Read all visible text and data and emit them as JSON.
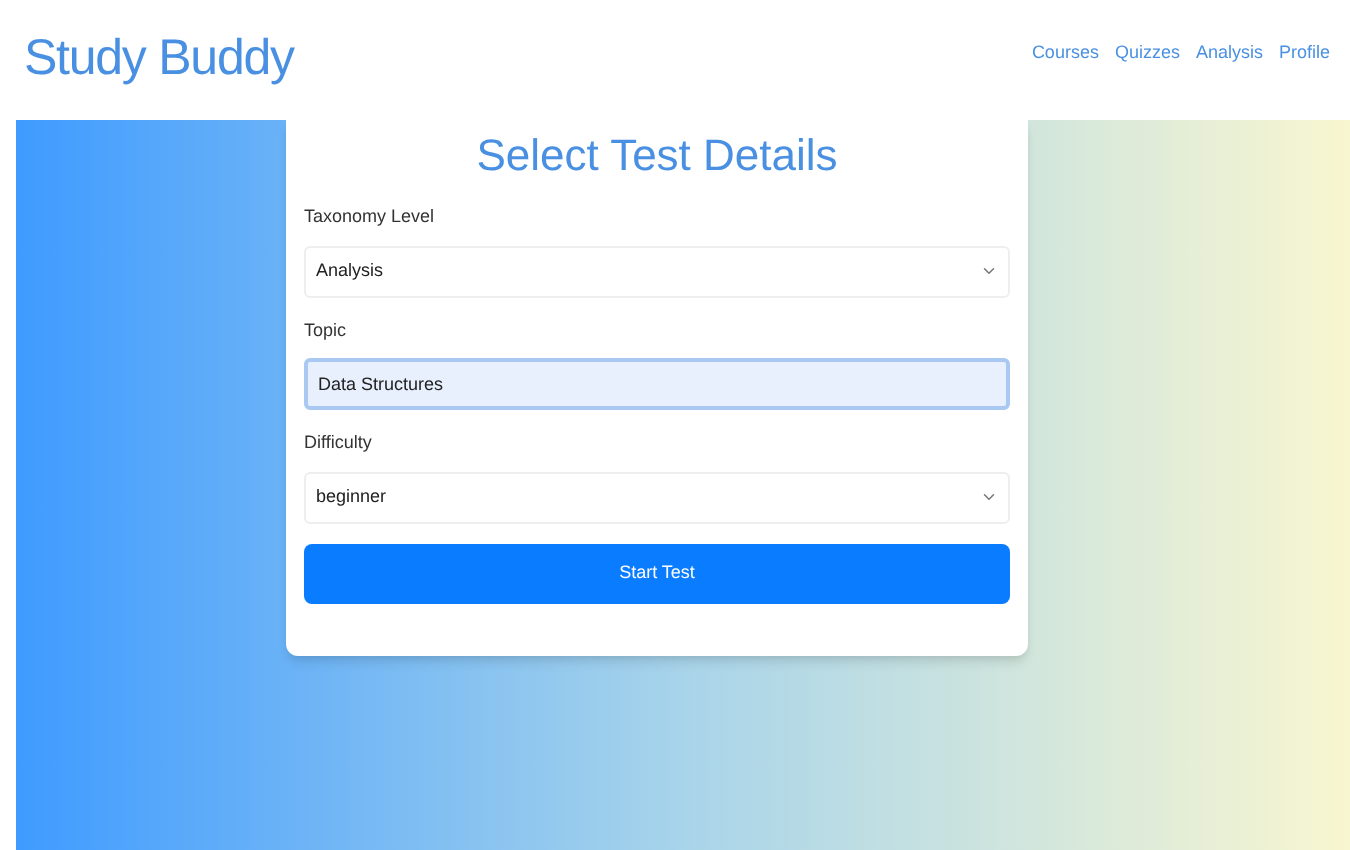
{
  "brand": "Study Buddy",
  "nav": [
    {
      "label": "Courses"
    },
    {
      "label": "Quizzes"
    },
    {
      "label": "Analysis"
    },
    {
      "label": "Profile"
    }
  ],
  "form": {
    "title": "Select Test Details",
    "fields": [
      {
        "kind": "select",
        "label": "Taxonomy Level",
        "value": "Analysis",
        "focused": false
      },
      {
        "kind": "text",
        "label": "Topic",
        "value": "Data Structures",
        "focused": true
      },
      {
        "kind": "select",
        "label": "Difficulty",
        "value": "beginner",
        "focused": false
      }
    ],
    "submit": "Start Test"
  }
}
